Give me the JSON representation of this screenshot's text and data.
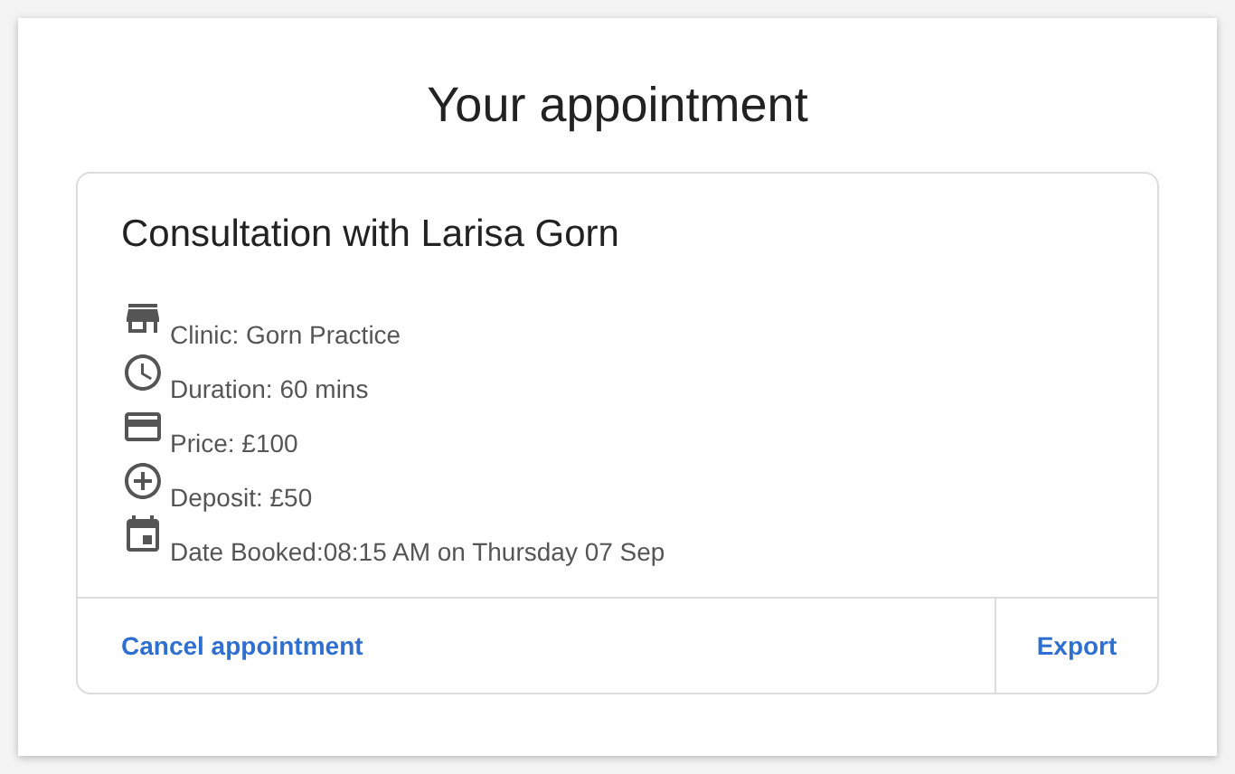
{
  "title": "Your appointment",
  "appointment": {
    "heading": "Consultation with Larisa Gorn",
    "details": [
      {
        "kind": "store",
        "text": "Clinic: Gorn Practice"
      },
      {
        "kind": "clock",
        "text": "Duration: 60 mins"
      },
      {
        "kind": "card",
        "text": "Price: £100"
      },
      {
        "kind": "plus",
        "text": "Deposit: £50"
      },
      {
        "kind": "calendar",
        "text": "Date Booked:08:15 AM on Thursday 07 Sep"
      }
    ],
    "actions": [
      {
        "kind": "cancel",
        "label": "Cancel appointment"
      },
      {
        "kind": "export",
        "label": "Export"
      }
    ]
  }
}
